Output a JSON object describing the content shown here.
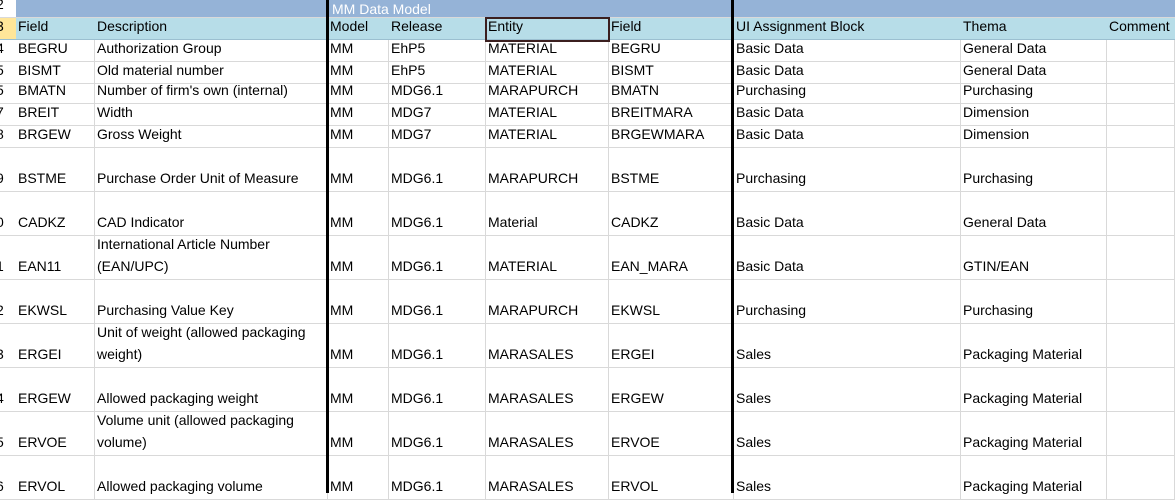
{
  "title_row": {
    "rownum": "2",
    "title": "MM Data Model"
  },
  "header_row": {
    "rownum": "3",
    "headers": [
      "Field",
      "Description",
      "Model",
      "Release",
      "Entity",
      "Field",
      "UI Assignment Block",
      "Thema",
      "Comment"
    ]
  },
  "rows": [
    {
      "rownum": "4",
      "field": "BEGRU",
      "description": "Authorization Group",
      "model": "MM",
      "release": "EhP5",
      "entity": "MATERIAL",
      "field2": "BEGRU",
      "ui_block": "Basic Data",
      "thema": "General Data",
      "comment": ""
    },
    {
      "rownum": "5",
      "field": "BISMT",
      "description": "Old material number",
      "model": "MM",
      "release": "EhP5",
      "entity": "MATERIAL",
      "field2": "BISMT",
      "ui_block": "Basic Data",
      "thema": "General Data",
      "comment": ""
    },
    {
      "rownum": "5",
      "field": "BMATN",
      "description": "Number of firm's own (internal)",
      "model": "MM",
      "release": "MDG6.1",
      "entity": "MARAPURCH",
      "field2": "BMATN",
      "ui_block": "Purchasing",
      "thema": "Purchasing",
      "comment": ""
    },
    {
      "rownum": "7",
      "field": "BREIT",
      "description": "Width",
      "model": "MM",
      "release": "MDG7",
      "entity": "MATERIAL",
      "field2": "BREITMARA",
      "ui_block": "Basic Data",
      "thema": "Dimension",
      "comment": ""
    },
    {
      "rownum": "8",
      "field": "BRGEW",
      "description": "Gross Weight",
      "model": "MM",
      "release": "MDG7",
      "entity": "MATERIAL",
      "field2": "BRGEWMARA",
      "ui_block": "Basic Data",
      "thema": "Dimension",
      "comment": ""
    },
    {
      "rownum": "9",
      "field": "BSTME",
      "description": "Purchase Order Unit of Measure",
      "model": "MM",
      "release": "MDG6.1",
      "entity": "MARAPURCH",
      "field2": "BSTME",
      "ui_block": "Purchasing",
      "thema": "Purchasing",
      "comment": ""
    },
    {
      "rownum": "0",
      "field": "CADKZ",
      "description": "CAD Indicator",
      "model": "MM",
      "release": "MDG6.1",
      "entity": "Material",
      "field2": "CADKZ",
      "ui_block": "Basic Data",
      "thema": "General Data",
      "comment": ""
    },
    {
      "rownum": "1",
      "field": "EAN11",
      "description": "International Article Number (EAN/UPC)",
      "model": "MM",
      "release": "MDG6.1",
      "entity": "MATERIAL",
      "field2": "EAN_MARA",
      "ui_block": "Basic Data",
      "thema": "GTIN/EAN",
      "comment": ""
    },
    {
      "rownum": "2",
      "field": "EKWSL",
      "description": "Purchasing Value Key",
      "model": "MM",
      "release": "MDG6.1",
      "entity": "MARAPURCH",
      "field2": "EKWSL",
      "ui_block": "Purchasing",
      "thema": "Purchasing",
      "comment": ""
    },
    {
      "rownum": "3",
      "field": "ERGEI",
      "description": "Unit of weight (allowed packaging weight)",
      "model": "MM",
      "release": "MDG6.1",
      "entity": "MARASALES",
      "field2": "ERGEI",
      "ui_block": "Sales",
      "thema": "Packaging Material",
      "comment": ""
    },
    {
      "rownum": "4",
      "field": "ERGEW",
      "description": "Allowed packaging weight",
      "model": "MM",
      "release": "MDG6.1",
      "entity": "MARASALES",
      "field2": "ERGEW",
      "ui_block": "Sales",
      "thema": "Packaging Material",
      "comment": ""
    },
    {
      "rownum": "5",
      "field": "ERVOE",
      "description": "Volume unit (allowed packaging volume)",
      "model": "MM",
      "release": "MDG6.1",
      "entity": "MARASALES",
      "field2": "ERVOE",
      "ui_block": "Sales",
      "thema": "Packaging Material",
      "comment": ""
    },
    {
      "rownum": "6",
      "field": "ERVOL",
      "description": "Allowed packaging volume",
      "model": "MM",
      "release": "MDG6.1",
      "entity": "MARASALES",
      "field2": "ERVOL",
      "ui_block": "Sales",
      "thema": "Packaging Material",
      "comment": ""
    }
  ]
}
